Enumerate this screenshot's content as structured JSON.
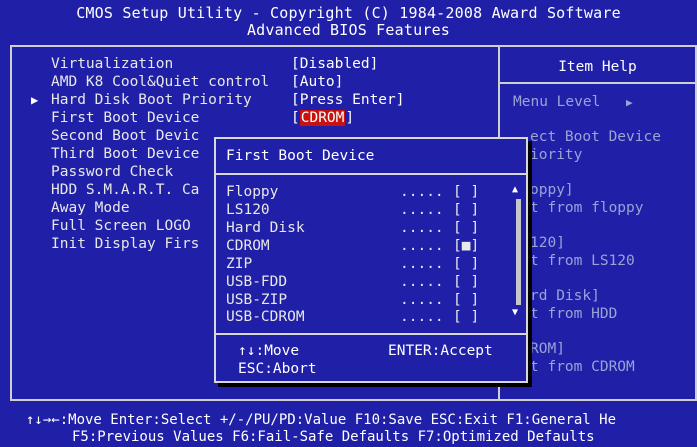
{
  "header": {
    "line1": "CMOS Setup Utility - Copyright (C) 1984-2008 Award Software",
    "line2": "Advanced BIOS Features"
  },
  "settings": [
    {
      "label": "Virtualization",
      "value": "[Disabled]"
    },
    {
      "label": "AMD K8 Cool&Quiet control",
      "value": "[Auto]"
    },
    {
      "label": "Hard Disk Boot Priority",
      "value": "[Press Enter]"
    },
    {
      "label": "First Boot Device",
      "value_open": "[",
      "value": "CDROM",
      "value_close": "]"
    },
    {
      "label": "Second Boot Devic",
      "value": ""
    },
    {
      "label": "Third Boot Device",
      "value": ""
    },
    {
      "label": "Password Check",
      "value": ""
    },
    {
      "label": "HDD S.M.A.R.T. Ca",
      "value": ""
    },
    {
      "label": "Away Mode",
      "value": ""
    },
    {
      "label": "Full Screen LOGO",
      "value": ""
    },
    {
      "label": "Init Display Firs",
      "value": ""
    }
  ],
  "item_help": {
    "title": "Item Help",
    "menu_level": "Menu Level",
    "menu_level_arrow": "▶",
    "lines": [
      "ect Boot Device",
      "iority",
      "",
      "oppy]",
      "t from floppy",
      "",
      "120]",
      "t from LS120",
      "",
      "rd Disk]",
      "t from HDD",
      "",
      "ROM]",
      "t from CDROM"
    ]
  },
  "popup": {
    "title": "First Boot Device",
    "options": [
      {
        "name": "Floppy",
        "dots": ".....",
        "mark": "[ ]"
      },
      {
        "name": "LS120",
        "dots": ".....",
        "mark": "[ ]"
      },
      {
        "name": "Hard Disk",
        "dots": ".....",
        "mark": "[ ]"
      },
      {
        "name": "CDROM",
        "dots": ".....",
        "mark": "[■]"
      },
      {
        "name": "ZIP",
        "dots": ".....",
        "mark": "[ ]"
      },
      {
        "name": "USB-FDD",
        "dots": ".....",
        "mark": "[ ]"
      },
      {
        "name": "USB-ZIP",
        "dots": ".....",
        "mark": "[ ]"
      },
      {
        "name": "USB-CDROM",
        "dots": ".....",
        "mark": "[ ]"
      }
    ],
    "nav_move": "↑↓:Move",
    "nav_accept": "ENTER:Accept",
    "nav_abort": "ESC:Abort",
    "scroll_up": "▲",
    "scroll_down": "▼"
  },
  "footer": {
    "line1": "↑↓→←:Move  Enter:Select  +/-/PU/PD:Value  F10:Save  ESC:Exit  F1:General He",
    "line2": "F5:Previous Values  F6:Fail-Safe Defaults  F7:Optimized Defaults"
  },
  "colors": {
    "background": "#1f1fa8",
    "highlight": "#c8120f",
    "help_text": "#9aa3d6"
  }
}
